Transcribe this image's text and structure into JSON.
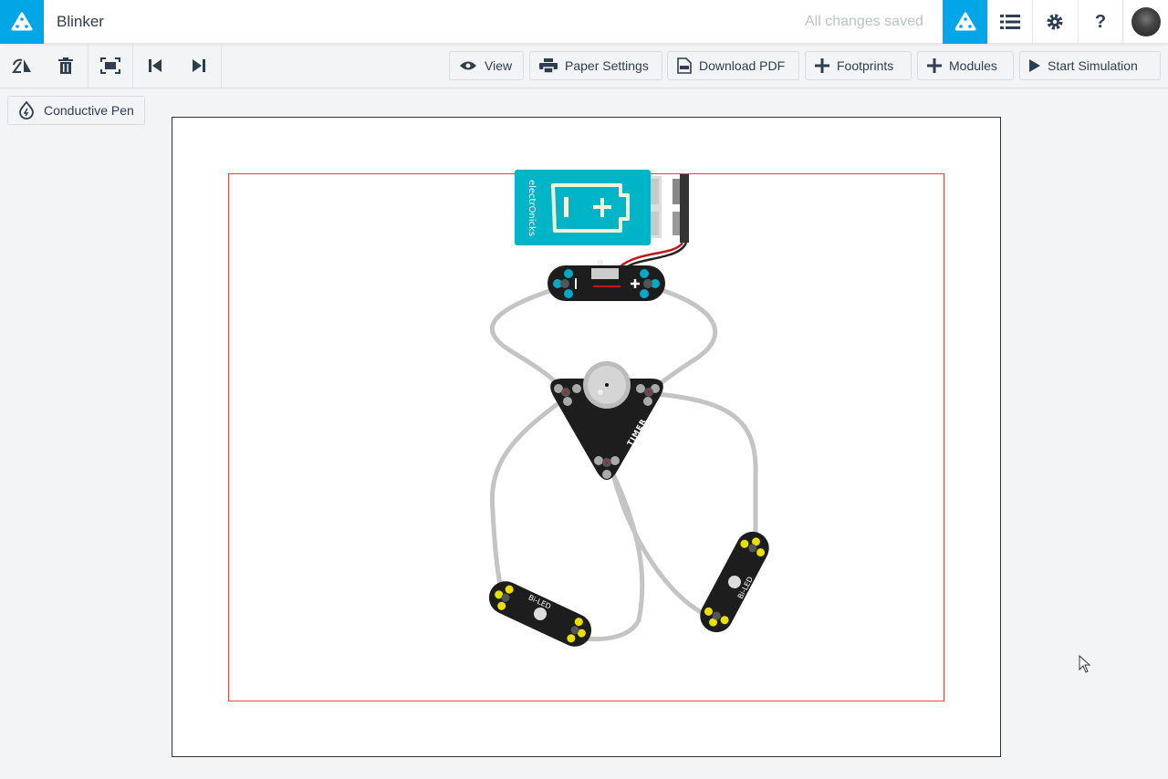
{
  "header": {
    "title": "Blinker",
    "status": "All changes saved",
    "icons": [
      "logo-icon",
      "list-icon",
      "gear-icon",
      "help-icon",
      "avatar"
    ],
    "help_label": "?"
  },
  "toolbar": {
    "left_icons": [
      "flip-icon",
      "trash-icon",
      "fit-screen-icon",
      "skip-back-icon",
      "skip-forward-icon"
    ],
    "view": "View",
    "paper_settings": "Paper Settings",
    "download_pdf": "Download PDF",
    "footprints": "Footprints",
    "modules": "Modules",
    "start_simulation": "Start Simulation"
  },
  "tools": {
    "conductive_pen": "Conductive Pen"
  },
  "colors": {
    "brand": "#00a6e6",
    "margin": "#f04444",
    "wire": "#c4c4c4",
    "battery": "#00b4c8",
    "module_pad": "#00a8c8",
    "led_pad": "#e8e000"
  },
  "canvas": {
    "modules": [
      "9V Battery",
      "Power",
      "Timer",
      "Bi-LED",
      "Bi-LED"
    ],
    "battery_brand": "electrOnicks"
  }
}
